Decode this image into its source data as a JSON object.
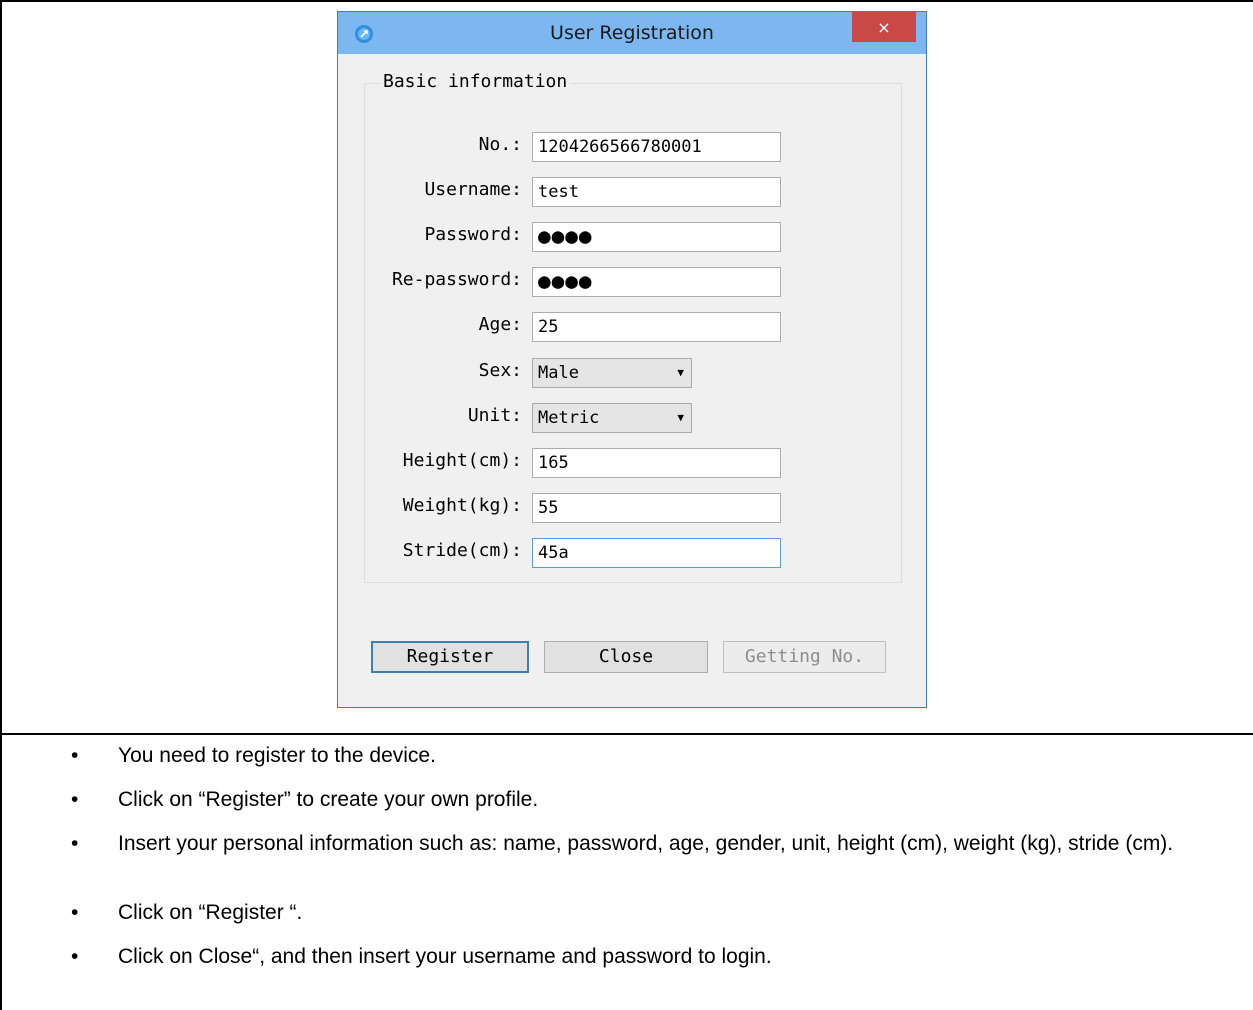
{
  "dialog": {
    "title": "User Registration",
    "close_glyph": "×",
    "group_title": "Basic information",
    "fields": [
      {
        "label": "No.:",
        "value": "1204266566780001"
      },
      {
        "label": "Username:",
        "value": "test"
      },
      {
        "label": "Password:",
        "value": "●●●●"
      },
      {
        "label": "Re-password:",
        "value": "●●●●"
      },
      {
        "label": "Age:",
        "value": "25"
      },
      {
        "label": "Sex:",
        "value": "Male"
      },
      {
        "label": "Unit:",
        "value": "Metric"
      },
      {
        "label": "Height(cm):",
        "value": "165"
      },
      {
        "label": "Weight(kg):",
        "value": "55"
      },
      {
        "label": "Stride(cm):",
        "value": "45a"
      }
    ],
    "buttons": {
      "register": "Register",
      "close": "Close",
      "getting_no": "Getting No."
    },
    "colors": {
      "title_bar": "#7db7f0",
      "close_button": "#c94949",
      "window_border": "#3a7bd5"
    },
    "icons": {
      "app": "app-icon",
      "close": "close-icon",
      "dropdown": "chevron-down-icon"
    }
  },
  "instructions": [
    "You need to register to the device.",
    "Click on “Register” to create your own profile.",
    "Insert your personal information such as: name, password, age, gender, unit, height (cm), weight (kg), stride (cm).",
    "Click on “Register “.",
    "Click on Close“, and then insert your username and password to login."
  ]
}
